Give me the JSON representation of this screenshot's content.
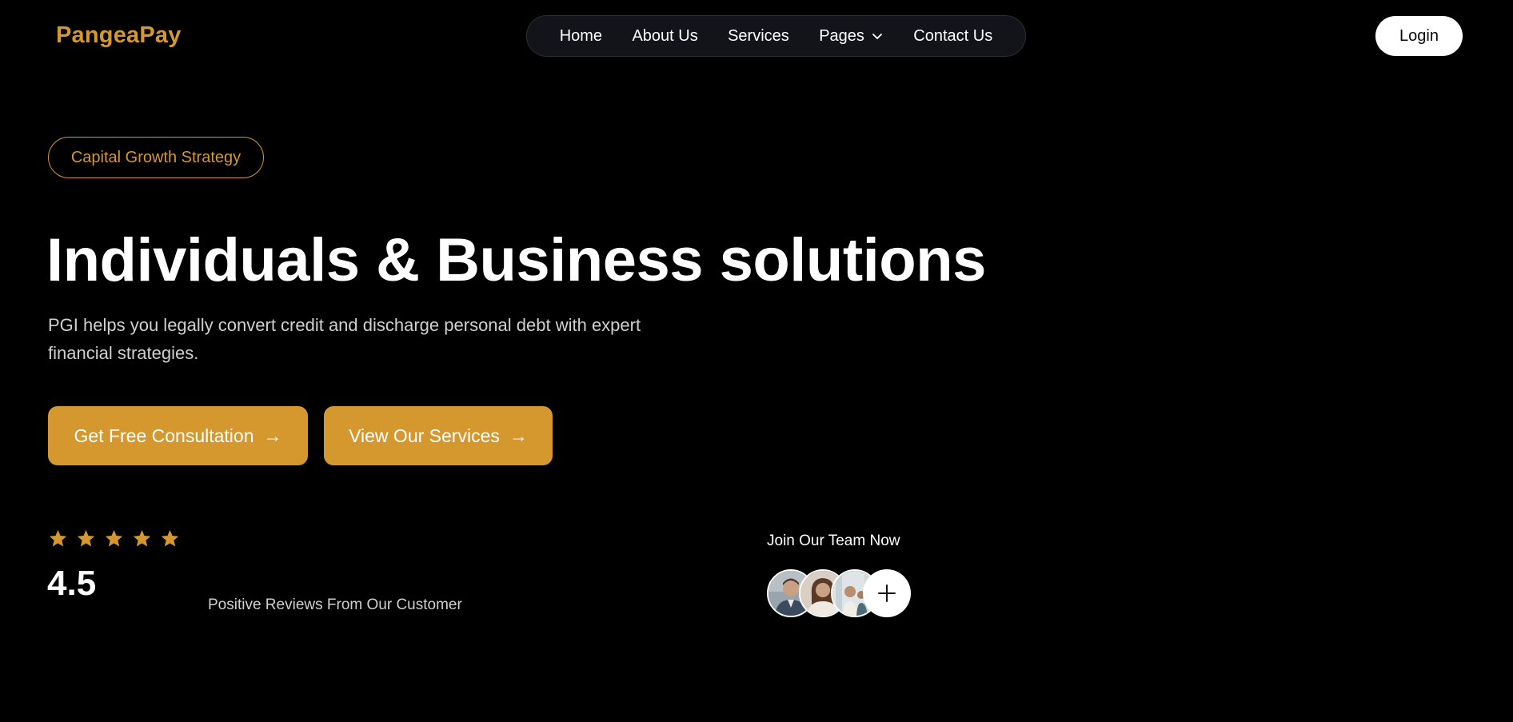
{
  "brand": {
    "name": "PangeaPay",
    "color": "#d4982e"
  },
  "nav": {
    "items": [
      {
        "label": "Home"
      },
      {
        "label": "About Us"
      },
      {
        "label": "Services"
      },
      {
        "label": "Pages",
        "icon": "chevron-down-icon"
      },
      {
        "label": "Contact Us"
      }
    ],
    "login_label": "Login"
  },
  "hero": {
    "tag": "Capital Growth Strategy",
    "title": "Individuals & Business solutions",
    "subtitle": "PGI helps you legally convert credit and discharge personal debt with expert financial strategies.",
    "cta_primary": "Get Free Consultation",
    "cta_secondary": "View Our Services",
    "cta_arrow": "→"
  },
  "reviews": {
    "stars": 5,
    "rating": "4.5",
    "label": "Positive Reviews From Our Customer"
  },
  "team": {
    "title": "Join Our Team Now",
    "add_icon": "plus-icon"
  },
  "colors": {
    "background": "#000000",
    "accent": "#d4982e",
    "nav_bg": "#121419",
    "text_muted": "#d0d0d0"
  }
}
